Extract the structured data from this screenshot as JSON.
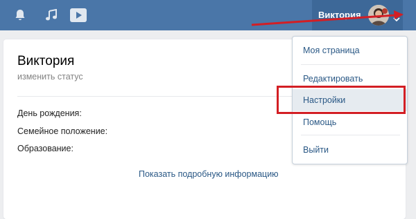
{
  "topbar": {
    "icons": [
      "bell-icon",
      "music-note-icon",
      "video-play-icon"
    ],
    "user_name": "Виктория",
    "avatar": "avatar-photo",
    "chevron": "chevron-down-icon",
    "bg_color": "#4a76a8"
  },
  "profile": {
    "name": "Виктория",
    "status_placeholder": "изменить статус",
    "info_labels": [
      "День рождения:",
      "Семейное положение:",
      "Образование:"
    ],
    "show_more": "Показать подробную информацию"
  },
  "dropdown": {
    "items": [
      {
        "label": "Моя страница"
      },
      {
        "label": "Редактировать"
      },
      {
        "label": "Настройки"
      },
      {
        "label": "Помощь"
      },
      {
        "label": "Выйти"
      }
    ],
    "highlighted_item": "Настройки",
    "link_color": "#2a5885"
  },
  "annotations": {
    "highlight_color": "#d31e24"
  }
}
